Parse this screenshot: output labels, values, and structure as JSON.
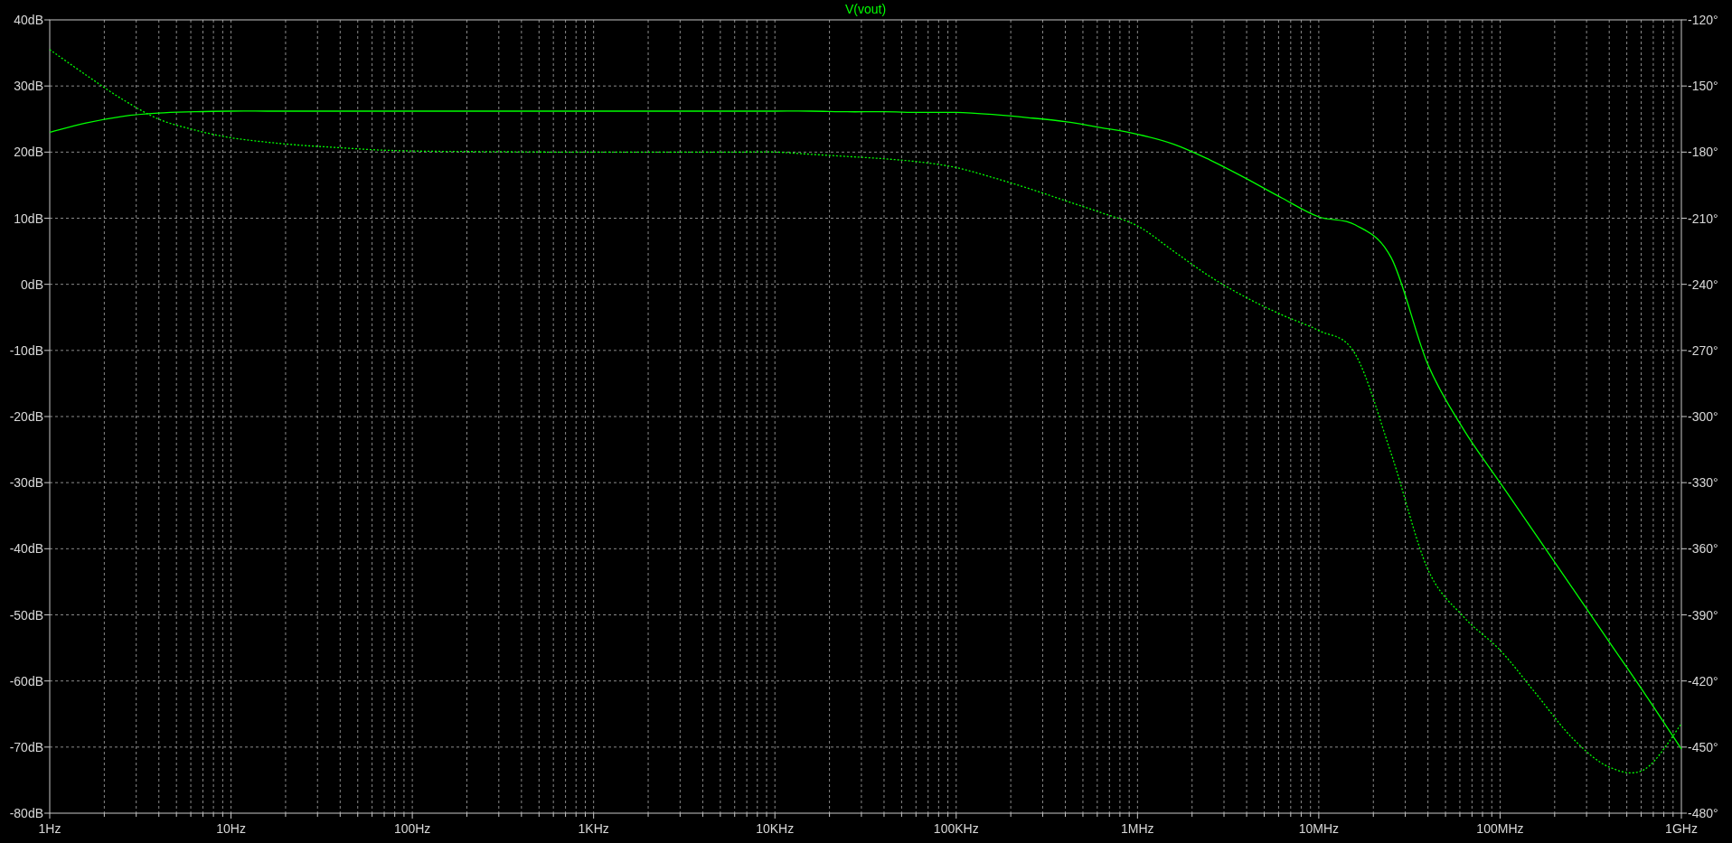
{
  "plot": {
    "chart_data": {
      "type": "line",
      "title": "V(vout)",
      "grid": true,
      "ylim": [
        -80,
        40
      ],
      "y2lim": [
        -480,
        -120
      ],
      "categories": [
        "1Hz",
        null,
        null,
        null,
        null,
        "10Hz",
        null,
        null,
        null,
        null,
        "100Hz",
        null,
        null,
        null,
        null,
        "1KHz",
        null,
        null,
        null,
        null,
        "10KHz",
        null,
        null,
        null,
        null,
        "100KHz",
        null,
        null,
        null,
        null,
        "1MHz",
        null,
        null,
        null,
        null,
        "10MHz",
        null,
        null,
        null,
        null,
        "100MHz",
        null,
        null,
        null,
        null,
        "1GHz"
      ],
      "yticks": [
        {
          "value": 40,
          "label": "40dB"
        },
        {
          "value": 30,
          "label": "30dB"
        },
        {
          "value": 20,
          "label": "20dB"
        },
        {
          "value": 10,
          "label": "10dB"
        },
        {
          "value": 0,
          "label": "0dB"
        },
        {
          "value": -10,
          "label": "-10dB"
        },
        {
          "value": -20,
          "label": "-20dB"
        },
        {
          "value": -30,
          "label": "-30dB"
        },
        {
          "value": -40,
          "label": "-40dB"
        },
        {
          "value": -50,
          "label": "-50dB"
        },
        {
          "value": -60,
          "label": "-60dB"
        },
        {
          "value": -70,
          "label": "-70dB"
        },
        {
          "value": -80,
          "label": "-80dB"
        }
      ],
      "y2ticks": [
        {
          "value": -120,
          "label": "-120°"
        },
        {
          "value": -150,
          "label": "-150°"
        },
        {
          "value": -180,
          "label": "-180°"
        },
        {
          "value": -210,
          "label": "-210°"
        },
        {
          "value": -240,
          "label": "-240°"
        },
        {
          "value": -270,
          "label": "-270°"
        },
        {
          "value": -300,
          "label": "-300°"
        },
        {
          "value": -330,
          "label": "-330°"
        },
        {
          "value": -360,
          "label": "-360°"
        },
        {
          "value": -390,
          "label": "-390°"
        },
        {
          "value": -420,
          "label": "-420°"
        },
        {
          "value": -450,
          "label": "-450°"
        },
        {
          "value": -480,
          "label": "-480°"
        }
      ],
      "series": [
        {
          "color": "#00ff00",
          "values": [
            23,
            24.4,
            25.4,
            25.9,
            26.1,
            26.2,
            26.2,
            26.2,
            26.2,
            26.2,
            26.2,
            26.2,
            26.2,
            26.2,
            26.2,
            26.2,
            26.2,
            26.2,
            26.2,
            26.2,
            26.2,
            26.2,
            26.1,
            26.1,
            26,
            26,
            25.7,
            25.2,
            24.6,
            23.7,
            22.7,
            21.2,
            18.8,
            16,
            13,
            10.2,
            9,
            4,
            -12,
            -22,
            -30,
            -38,
            -46,
            -54,
            -62,
            -70.3
          ]
        },
        {
          "axis": "y2",
          "line_style": "dotted",
          "color": "#00ff00",
          "values": [
            -133.5,
            -145,
            -156,
            -165,
            -170,
            -173.5,
            -175.5,
            -177,
            -178,
            -179,
            -179.5,
            -179.7,
            -179.8,
            -179.9,
            -180,
            -180,
            -180,
            -180,
            -180,
            -180,
            -180,
            -181,
            -182,
            -183,
            -184.5,
            -187,
            -191.5,
            -196.5,
            -202,
            -207.5,
            -213.5,
            -225,
            -236.5,
            -246,
            -254,
            -261,
            -271.5,
            -317,
            -369,
            -391,
            -406,
            -426,
            -446,
            -459,
            -460,
            -439.5
          ]
        }
      ]
    }
  }
}
